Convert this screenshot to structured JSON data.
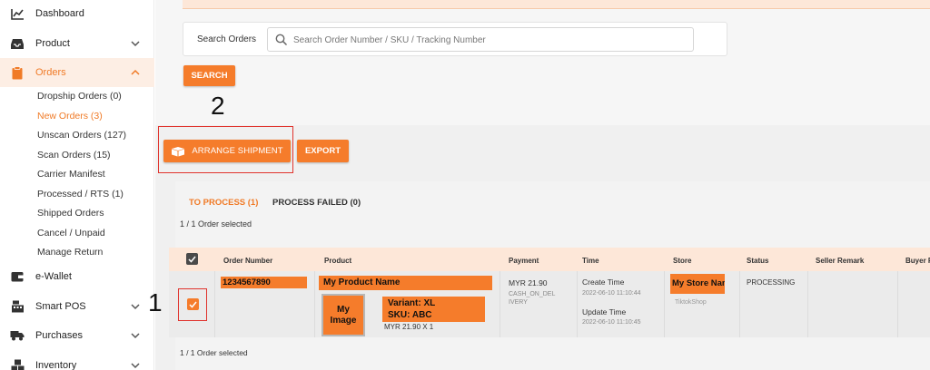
{
  "sidebar": {
    "items": [
      {
        "label": "Dashboard",
        "icon": "chart-line-icon"
      },
      {
        "label": "Product",
        "icon": "inbox-icon"
      },
      {
        "label": "Orders",
        "icon": "clipboard-icon"
      },
      {
        "label": "e-Wallet",
        "icon": "wallet-icon"
      },
      {
        "label": "Smart POS",
        "icon": "cash-register-icon"
      },
      {
        "label": "Purchases",
        "icon": "truck-icon"
      },
      {
        "label": "Inventory",
        "icon": "boxes-icon"
      }
    ],
    "orders_sub": [
      "Dropship Orders (0)",
      "New Orders (3)",
      "Unscan Orders (127)",
      "Scan Orders (15)",
      "Carrier Manifest",
      "Processed / RTS (1)",
      "Shipped Orders",
      "Cancel / Unpaid",
      "Manage Return"
    ]
  },
  "search": {
    "label": "Search Orders",
    "placeholder": "Search Order Number / SKU / Tracking Number",
    "button": "SEARCH"
  },
  "actions": {
    "arrange": "ARRANGE SHIPMENT",
    "export": "EXPORT"
  },
  "annotations": {
    "one": "1",
    "two": "2"
  },
  "tabs": {
    "to_process": "TO PROCESS (1)",
    "process_failed": "PROCESS FAILED (0)"
  },
  "selected_text": "1 / 1 Order selected",
  "table": {
    "headers": [
      "Order Number",
      "Product",
      "Payment",
      "Time",
      "Store",
      "Status",
      "Seller Remark",
      "Buyer R"
    ],
    "row": {
      "order_number": "1234567890",
      "product_name": "My Product Name",
      "image_line1": "My",
      "image_line2": "Image",
      "variant": "Variant: XL",
      "sku": "SKU: ABC",
      "price_qty": "MYR 21.90 X 1",
      "payment_amount": "MYR 21.90",
      "payment_method": "CASH_ON_DEL IVERY",
      "create_label": "Create Time",
      "create_value": "2022-06-10 11:10:44",
      "update_label": "Update Time",
      "update_value": "2022-06-10 11:10:45",
      "store_name": "My Store Name",
      "store_platform": "TiktokShop",
      "status": "PROCESSING"
    }
  },
  "colors": {
    "accent": "#f57c2b",
    "active_bg": "#fdeee4",
    "highlight": "#e0332d"
  }
}
